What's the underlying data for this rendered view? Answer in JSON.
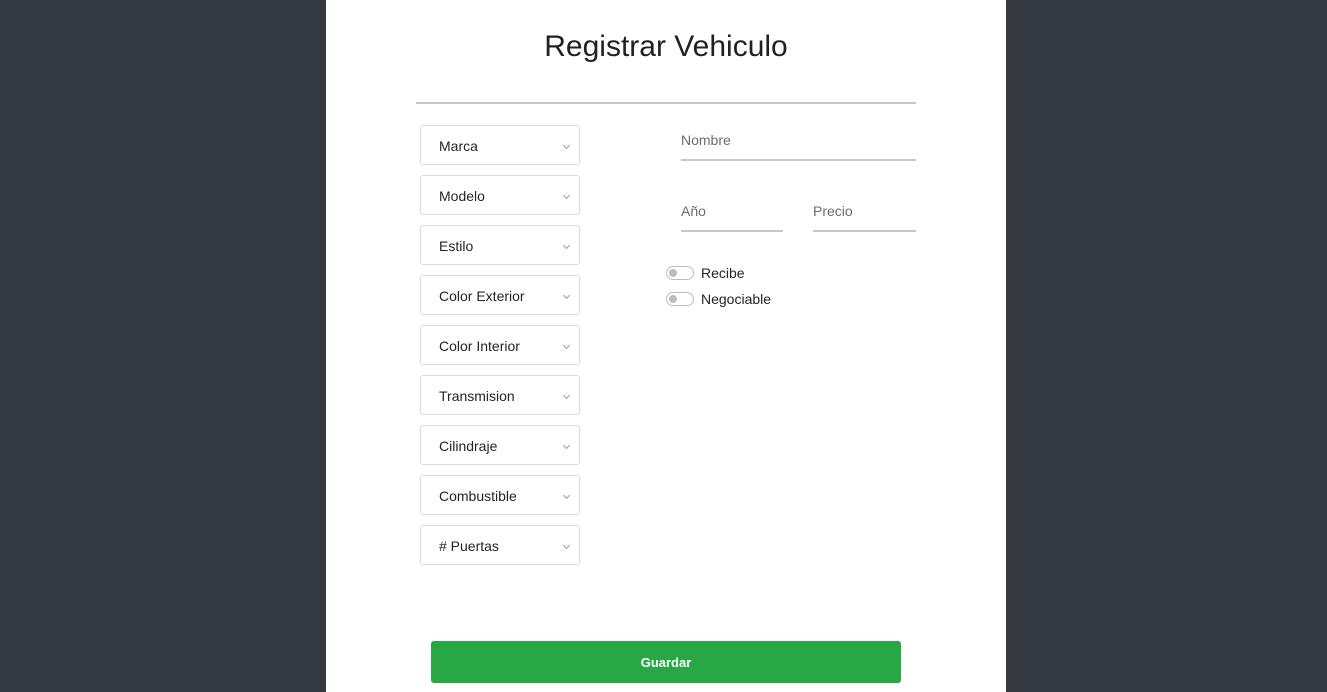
{
  "form": {
    "title": "Registrar Vehiculo",
    "selects": [
      {
        "label": "Marca"
      },
      {
        "label": "Modelo"
      },
      {
        "label": "Estilo"
      },
      {
        "label": "Color Exterior"
      },
      {
        "label": "Color Interior"
      },
      {
        "label": "Transmision"
      },
      {
        "label": "Cilindraje"
      },
      {
        "label": "Combustible"
      },
      {
        "label": "# Puertas"
      }
    ],
    "fields": {
      "nombre_placeholder": "Nombre",
      "anio_placeholder": "Año",
      "precio_placeholder": "Precio"
    },
    "toggles": [
      {
        "label": "Recibe",
        "checked": false
      },
      {
        "label": "Negociable",
        "checked": false
      }
    ],
    "save_label": "Guardar"
  },
  "colors": {
    "background": "#343a40",
    "panel": "#ffffff",
    "save_button": "#28a745"
  },
  "icons": {
    "select_arrow": "chevron-down-icon"
  }
}
